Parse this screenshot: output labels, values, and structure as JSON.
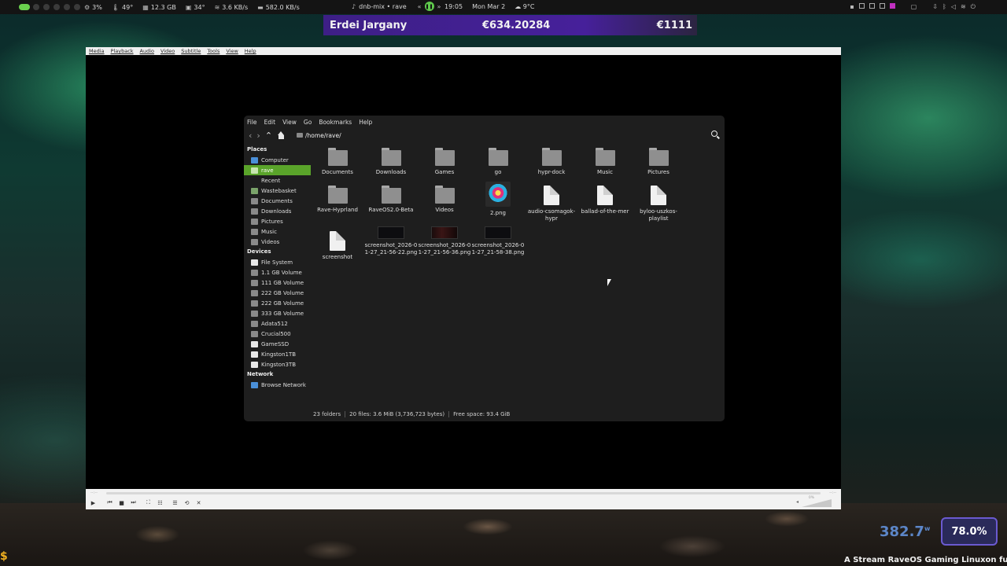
{
  "topbar": {
    "cpu": "3%",
    "cpu_temp": "49°",
    "ram": "12.3 GB",
    "gpu_temp": "34°",
    "net_speed": "3.6 KB/s",
    "disk_speed": "582.0 KB/s",
    "music": "dnb-mix • rave",
    "time": "19:05",
    "date": "Mon Mar 2",
    "weather": "9°C"
  },
  "banner": {
    "name": "Erdei Jargany",
    "amount": "€634.20284",
    "total": "€1111"
  },
  "vlc": {
    "menu": [
      "Media",
      "Playback",
      "Audio",
      "Video",
      "Subtitle",
      "Tools",
      "View",
      "Help"
    ],
    "time_left": "--:--",
    "time_right": "--:--",
    "volume": "0%"
  },
  "fm": {
    "menu": [
      "File",
      "Edit",
      "View",
      "Go",
      "Bookmarks",
      "Help"
    ],
    "path": "/home/rave/",
    "places_title": "Places",
    "places": [
      "Computer",
      "rave",
      "Recent",
      "Wastebasket",
      "Documents",
      "Downloads",
      "Pictures",
      "Music",
      "Videos"
    ],
    "devices_title": "Devices",
    "devices": [
      "File System",
      "1.1 GB Volume",
      "111 GB Volume",
      "222 GB Volume",
      "222 GB Volume",
      "333 GB Volume",
      "Adata512",
      "Crucial500",
      "GameSSD",
      "Kingston1TB",
      "Kingston3TB"
    ],
    "network_title": "Network",
    "network": [
      "Browse Network"
    ],
    "items": [
      {
        "name": "Documents",
        "type": "folder"
      },
      {
        "name": "Downloads",
        "type": "folder"
      },
      {
        "name": "Games",
        "type": "folder"
      },
      {
        "name": "go",
        "type": "folder"
      },
      {
        "name": "hypr-dock",
        "type": "folder"
      },
      {
        "name": "Music",
        "type": "folder"
      },
      {
        "name": "Pictures",
        "type": "folder"
      },
      {
        "name": "Rave-Hyprland",
        "type": "folder"
      },
      {
        "name": "RaveOS2.0-Beta",
        "type": "folder"
      },
      {
        "name": "Videos",
        "type": "folder"
      },
      {
        "name": "2.png",
        "type": "image"
      },
      {
        "name": "audio-csomagok-hypr",
        "type": "file"
      },
      {
        "name": "ballad-of-the-mer",
        "type": "file"
      },
      {
        "name": "byloo-uszkos-playlist",
        "type": "file"
      },
      {
        "name": "screenshot",
        "type": "file"
      },
      {
        "name": "screenshot_2026-01-27_21-56-22.png",
        "type": "shot"
      },
      {
        "name": "screenshot_2026-01-27_21-56-36.png",
        "type": "shot"
      },
      {
        "name": "screenshot_2026-01-27_21-58-38.png",
        "type": "shot"
      }
    ],
    "status": {
      "folders": "23 folders",
      "files": "20 files: 3.6 MiB (3,736,723 bytes)",
      "free": "Free space: 93.4 GiB"
    }
  },
  "overlay": {
    "power": "382.7",
    "power_unit": "w",
    "percent": "78.0%",
    "ticker": "A Stream RaveOS Gaming Linuxon fut"
  }
}
